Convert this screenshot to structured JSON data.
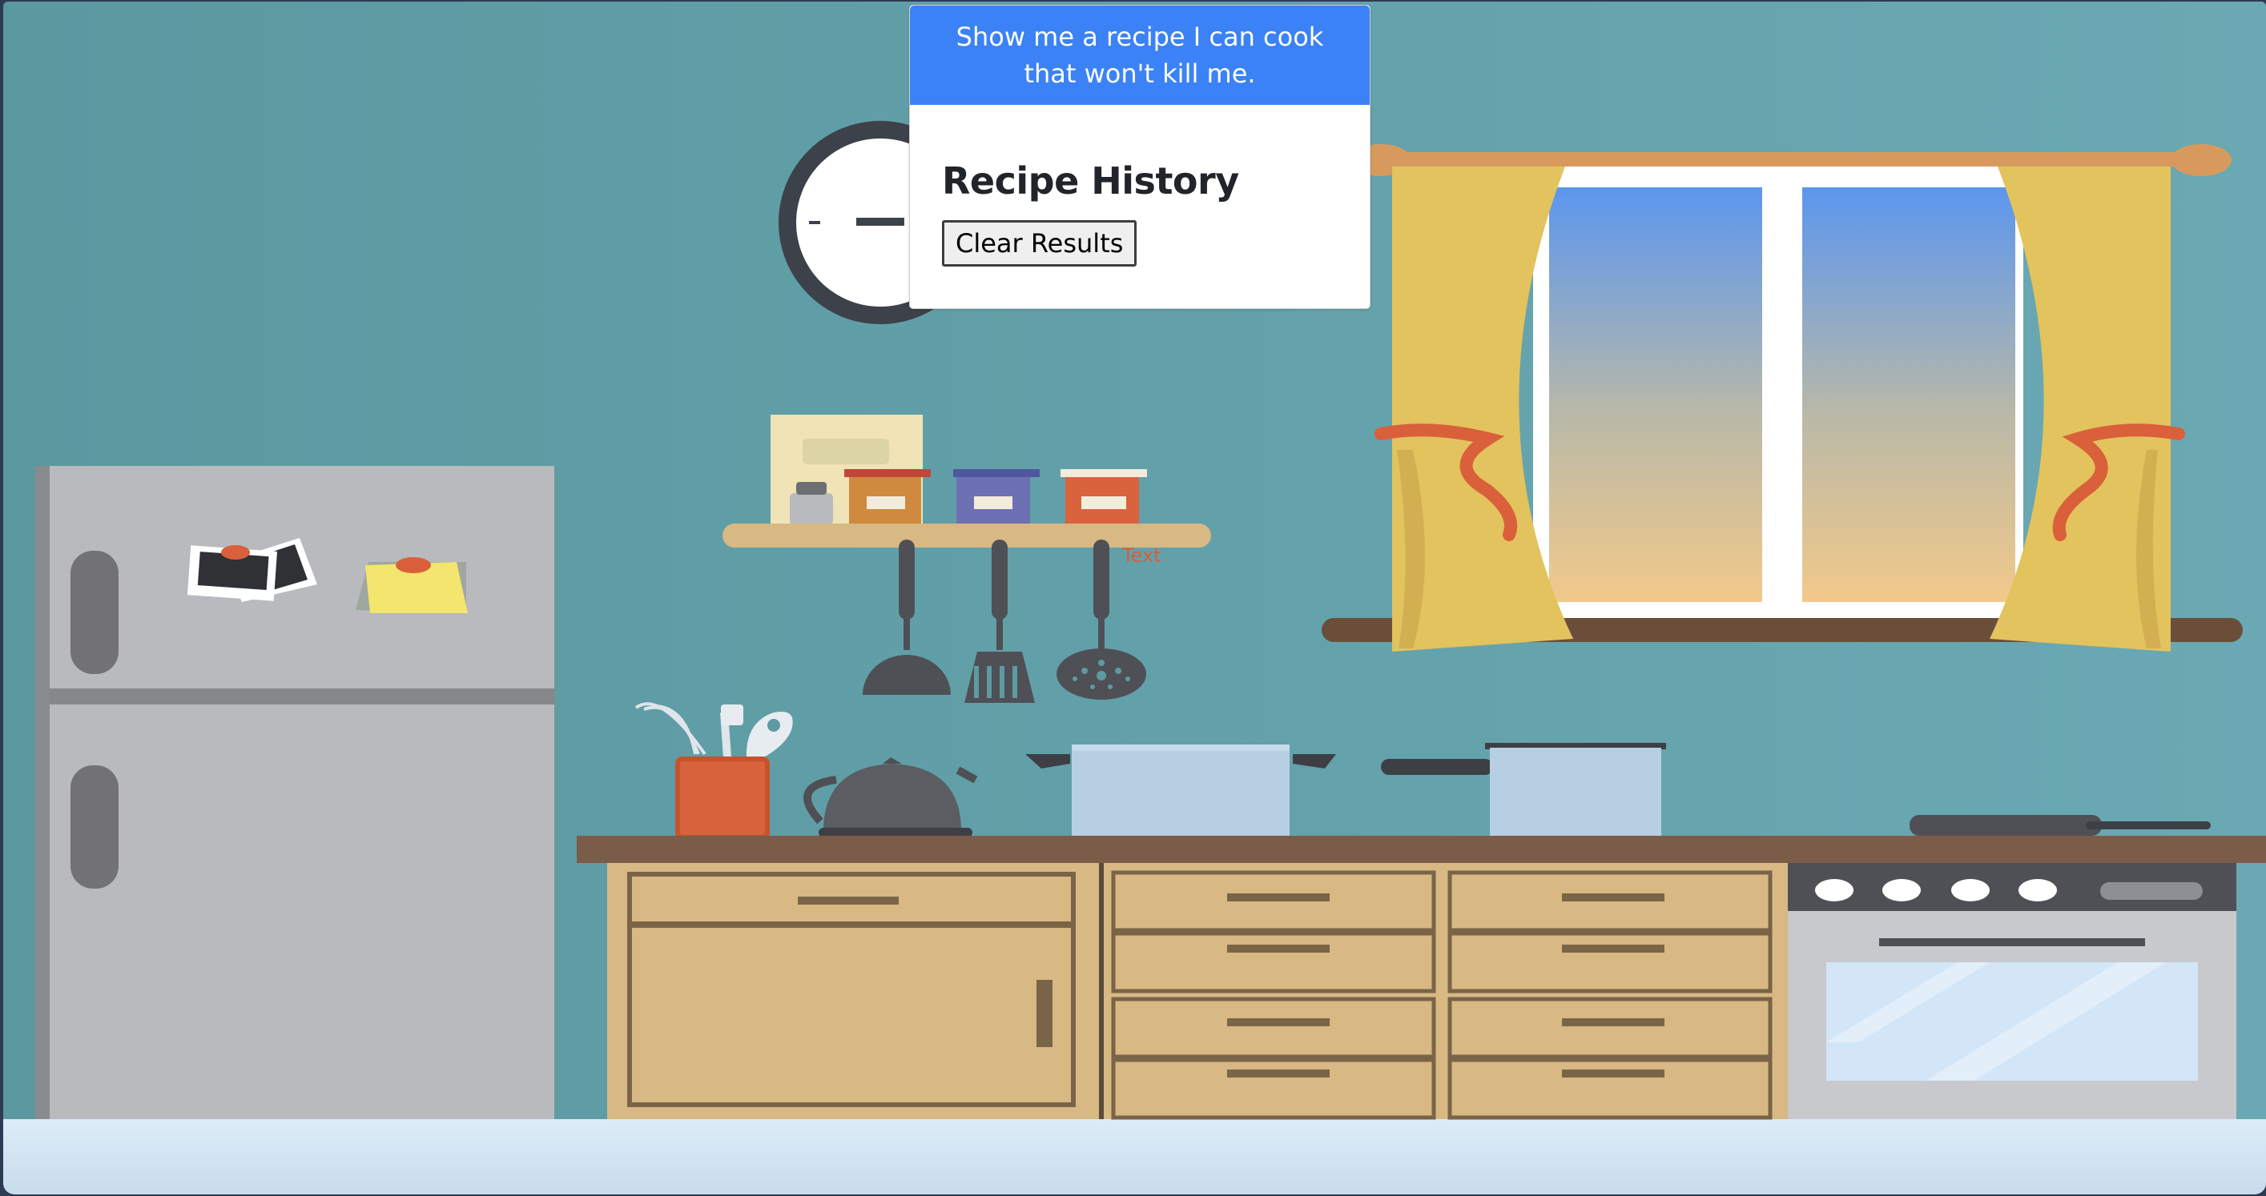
{
  "main_button": {
    "label": "Show me a recipe I can cook that won't kill me."
  },
  "history": {
    "title": "Recipe History",
    "clear_label": "Clear Results"
  },
  "shelf_label": {
    "text": "Text"
  },
  "colors": {
    "wall_gradient": [
      "#5c9aa2",
      "#6aa8b2"
    ],
    "accent_blue": "#3b82f6",
    "curtain_yellow": "#e2c35e",
    "tie_orange": "#d9603a",
    "cabinet_tan": "#d8b883",
    "counter_brown": "#7a5c48",
    "fridge_gray": "#b8babe",
    "floor_light": "#d8eaf7"
  },
  "icons": [
    "clock-icon",
    "fridge-icon",
    "photo-icon",
    "sticky-note-icon",
    "spice-jar-icon",
    "ladle-icon",
    "spatula-icon",
    "skimmer-icon",
    "whisk-icon",
    "kettle-icon",
    "pot-icon",
    "frying-pan-icon",
    "stove-icon"
  ]
}
